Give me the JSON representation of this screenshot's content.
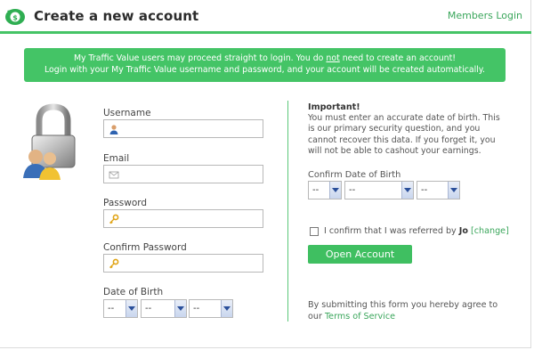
{
  "header": {
    "title": "Create a new account",
    "members_login": "Members Login"
  },
  "banner": {
    "line1_part1": "My Traffic Value users may proceed straight to login. You do ",
    "line1_not": "not",
    "line1_part2": " need to create an account!",
    "line2": "Login with your My Traffic Value username and password, and your account will be created automatically."
  },
  "form": {
    "username_label": "Username",
    "username_value": "",
    "email_label": "Email",
    "email_value": "",
    "password_label": "Password",
    "password_value": "",
    "confirm_password_label": "Confirm Password",
    "confirm_password_value": "",
    "dob_label": "Date of Birth",
    "dob_month": "--",
    "dob_day": "--",
    "dob_year": "--"
  },
  "right": {
    "important_title": "Important!",
    "important_text": "You must enter an accurate date of birth. This is our primary security question, and you cannot recover this data. If you forget it, you will not be able to cashout your earnings.",
    "confirm_dob_label": "Confirm Date of Birth",
    "confirm_month": "--",
    "confirm_day": "--",
    "confirm_year": "--",
    "referred_text": "I confirm that I was referred by ",
    "referrer": "Jo",
    "change_link": "[change]",
    "open_account_button": "Open Account",
    "terms_prefix": "By submitting this form you hereby agree to our ",
    "terms_link": "Terms of Service"
  },
  "colors": {
    "accent": "#44c466",
    "link": "#3aa65b"
  },
  "icons": {
    "logo": "piggy-bank-logo-icon",
    "lock": "padlock-users-icon",
    "username": "user-icon",
    "email": "envelope-icon",
    "password": "key-icon"
  }
}
